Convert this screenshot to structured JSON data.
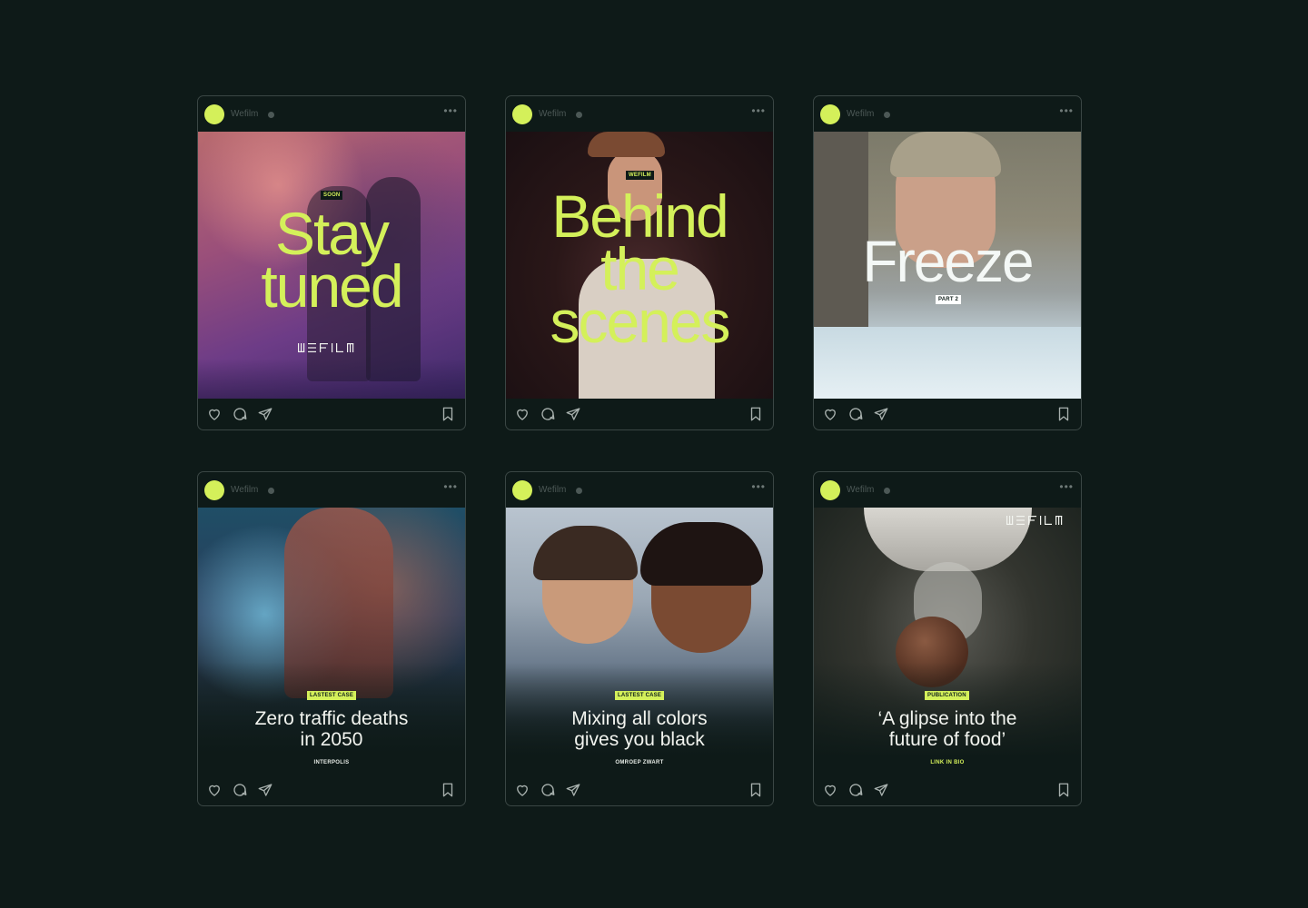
{
  "account": {
    "name": "Wefilm",
    "avatar_color": "#d4f05a"
  },
  "accent_color": "#d4f05a",
  "icons": [
    "verified-icon",
    "more-icon",
    "heart-icon",
    "comment-icon",
    "share-icon",
    "bookmark-icon"
  ],
  "posts": [
    {
      "tag": "SOON",
      "headline_lines": [
        "Stay",
        "tuned"
      ],
      "logo": "WEFILM"
    },
    {
      "tag": "WEFILM",
      "headline_lines": [
        "Behind",
        "the",
        "scenes"
      ]
    },
    {
      "tag": "PART 2",
      "headline": "Freeze"
    },
    {
      "tag": "LASTEST CASE",
      "title_lines": [
        "Zero traffic deaths",
        "in 2050"
      ],
      "subtitle": "INTERPOLIS"
    },
    {
      "tag": "LASTEST CASE",
      "title_lines": [
        "Mixing all colors",
        "gives you black"
      ],
      "subtitle": "OMROEP ZWART"
    },
    {
      "tag": "PUBLICATION",
      "title_lines": [
        "‘A glipse into the",
        "future of food’"
      ],
      "subtitle": "LINK IN BIO",
      "logo": "WEFILM"
    }
  ]
}
